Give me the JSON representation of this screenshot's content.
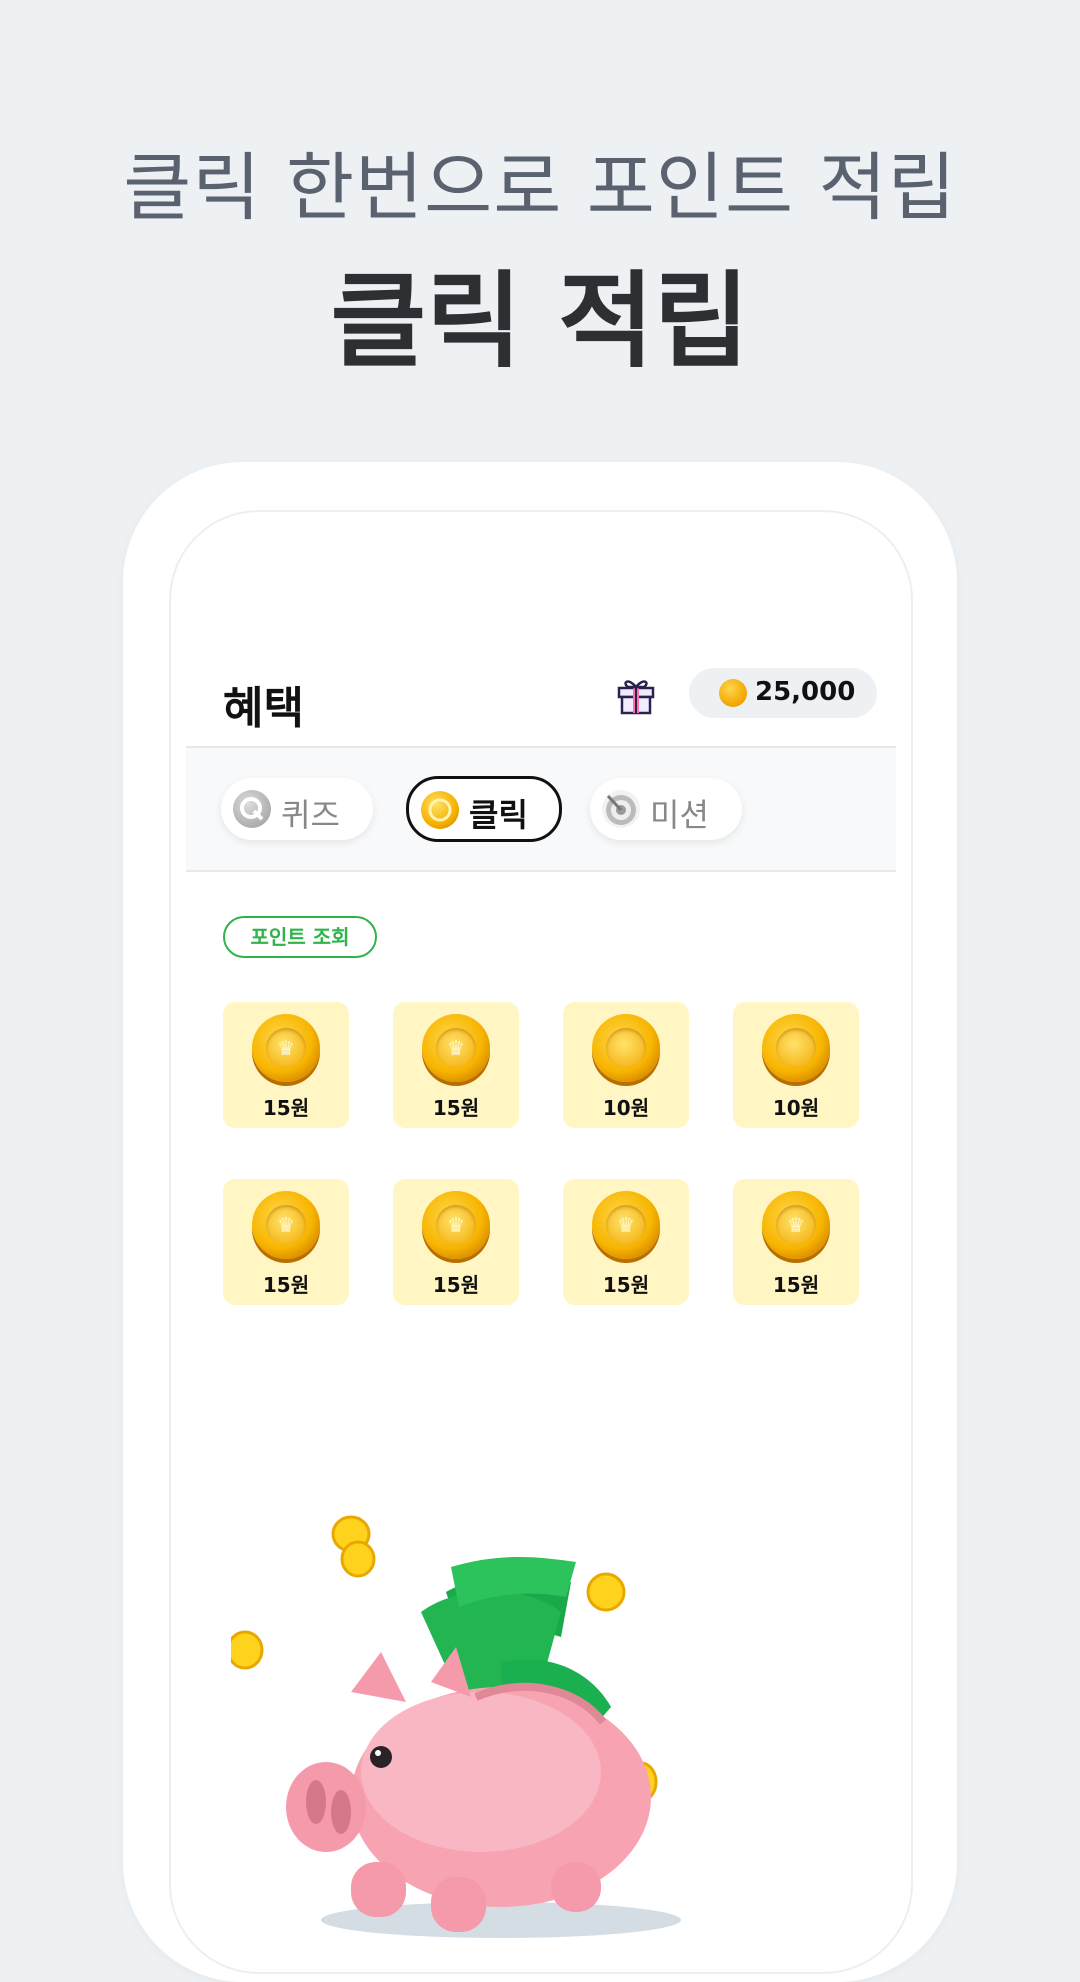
{
  "promo": {
    "subtitle": "클릭 한번으로 포인트 적립",
    "title": "클릭 적립"
  },
  "app": {
    "title": "혜택",
    "gift_icon": "gift-icon",
    "points": "25,000"
  },
  "tabs": [
    {
      "label": "퀴즈",
      "icon": "quiz-q-icon",
      "active": false
    },
    {
      "label": "클릭",
      "icon": "coin-icon",
      "active": true
    },
    {
      "label": "미션",
      "icon": "target-icon",
      "active": false
    }
  ],
  "point_check_label": "포인트 조회",
  "coins": [
    {
      "amount": "15원",
      "type": "crown"
    },
    {
      "amount": "15원",
      "type": "crown"
    },
    {
      "amount": "10원",
      "type": "plain"
    },
    {
      "amount": "10원",
      "type": "plain"
    },
    {
      "amount": "15원",
      "type": "crown"
    },
    {
      "amount": "15원",
      "type": "crown"
    },
    {
      "amount": "15원",
      "type": "crown"
    },
    {
      "amount": "15원",
      "type": "crown"
    }
  ],
  "colors": {
    "background": "#eef1f4",
    "accent_green": "#2fb34a",
    "coin_card": "#fff6c4",
    "coin_gold": "#f7b500"
  }
}
